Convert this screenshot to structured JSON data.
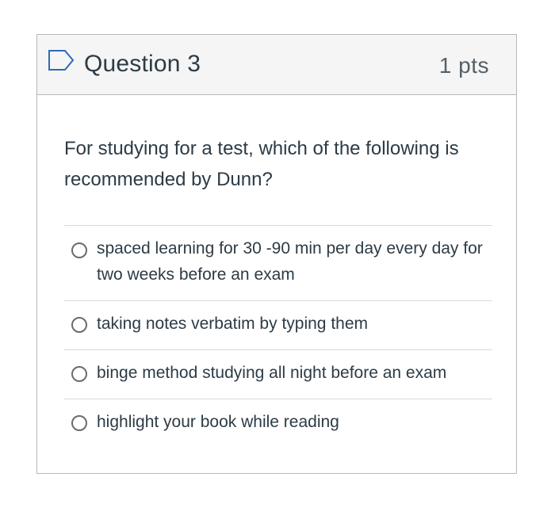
{
  "question": {
    "title": "Question 3",
    "points": "1 pts",
    "flag_icon": "flag-outline-icon",
    "text": "For studying for a test, which of the following is recommended by Dunn?",
    "answers": [
      {
        "label": "spaced learning for 30 -90 min per day every day for two weeks before an exam",
        "selected": false
      },
      {
        "label": "taking notes verbatim by typing them",
        "selected": false
      },
      {
        "label": "binge method studying all night before an exam",
        "selected": false
      },
      {
        "label": "highlight your book while reading",
        "selected": false
      }
    ]
  },
  "colors": {
    "header_bg": "#f5f5f5",
    "border": "#b8b8b8",
    "flag_stroke": "#2d6bb5",
    "text": "#2d3b45"
  }
}
